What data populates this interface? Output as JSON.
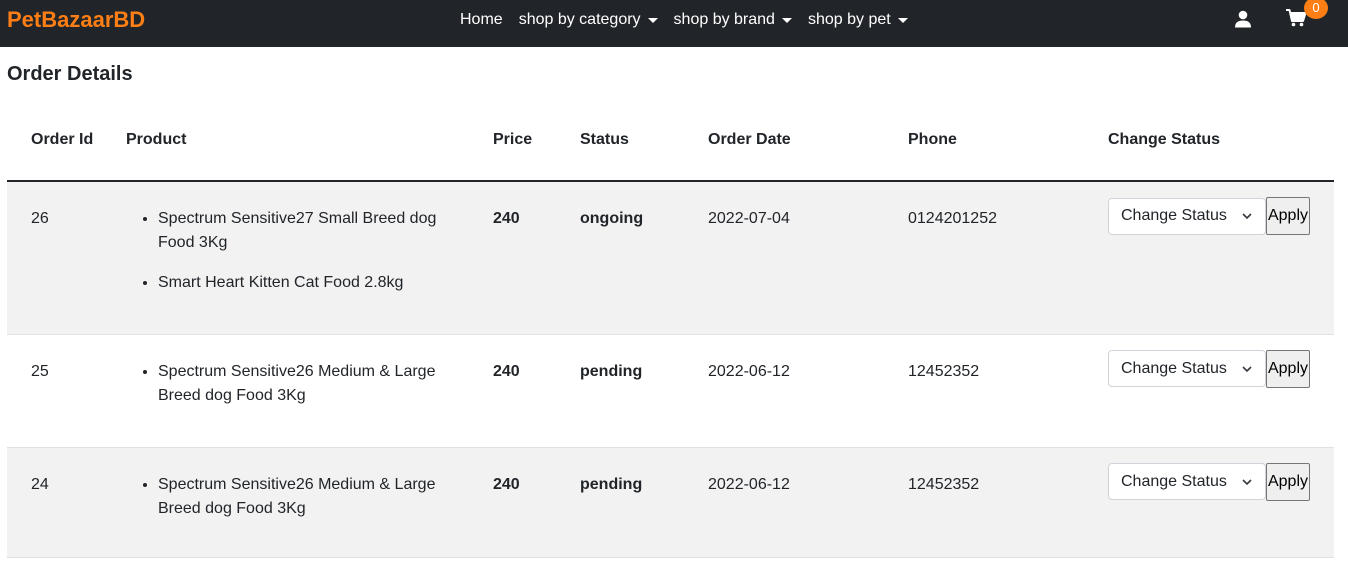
{
  "nav": {
    "brand": "PetBazaarBD",
    "links": [
      {
        "label": "Home",
        "dropdown": false
      },
      {
        "label": "shop by category",
        "dropdown": true
      },
      {
        "label": "shop by brand",
        "dropdown": true
      },
      {
        "label": "shop by pet",
        "dropdown": true
      }
    ],
    "user_icon": "user-icon",
    "cart_icon": "shopping-cart-icon",
    "cart_count": "0"
  },
  "page": {
    "title": "Order Details"
  },
  "table": {
    "headers": {
      "order_id": "Order Id",
      "product": "Product",
      "price": "Price",
      "status": "Status",
      "order_date": "Order Date",
      "phone": "Phone",
      "change_status": "Change Status"
    },
    "rows": [
      {
        "order_id": "26",
        "products": [
          "Spectrum Sensitive27 Small Breed dog Food 3Kg",
          "Smart Heart Kitten Cat Food 2.8kg"
        ],
        "price": "240",
        "status": "ongoing",
        "order_date": "2022-07-04",
        "phone": "0124201252",
        "select_value": "Change Status",
        "apply_label": "Apply"
      },
      {
        "order_id": "25",
        "products": [
          "Spectrum Sensitive26 Medium & Large Breed dog Food 3Kg"
        ],
        "price": "240",
        "status": "pending",
        "order_date": "2022-06-12",
        "phone": "12452352",
        "select_value": "Change Status",
        "apply_label": "Apply"
      },
      {
        "order_id": "24",
        "products": [
          "Spectrum Sensitive26 Medium & Large Breed dog Food 3Kg"
        ],
        "price": "240",
        "status": "pending",
        "order_date": "2022-06-12",
        "phone": "12452352",
        "select_value": "Change Status",
        "apply_label": "Apply"
      }
    ]
  },
  "colors": {
    "navbar_bg": "#212529",
    "brand": "#fd7e14",
    "badge": "#fd7e14",
    "stripe": "#f2f2f2"
  }
}
